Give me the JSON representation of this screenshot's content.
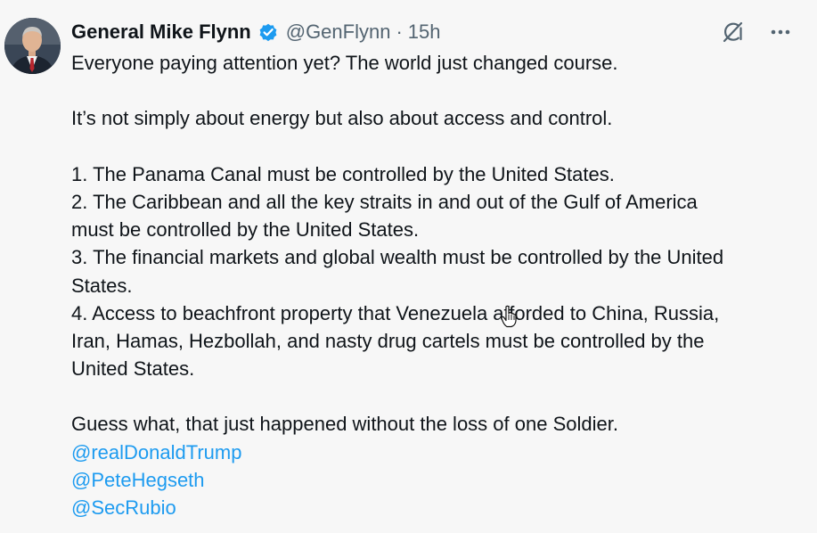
{
  "post": {
    "display_name": "General Mike Flynn",
    "handle": "@GenFlynn",
    "separator": "·",
    "time": "15h",
    "verified_icon": "verified-badge-icon",
    "actions": {
      "grok_icon": "grok-icon",
      "more_icon": "more-horizontal-icon"
    },
    "lines": [
      "Everyone paying attention yet? The world just changed course.",
      "",
      "It’s not simply about energy but also about access and control.",
      "",
      "1. The Panama Canal must be controlled by the United States.",
      "2. The Caribbean and all the key straits in and out of the Gulf of America",
      "must be controlled by the United States.",
      "3. The financial markets and global wealth must be controlled by the United",
      "States.",
      "4. Access to beachfront property that Venezuela afforded to China, Russia,",
      "Iran, Hamas, Hezbollah, and nasty drug cartels must be controlled by the",
      "United States.",
      "",
      "Guess what, that just happened without the loss of one Soldier."
    ],
    "mentions": [
      "@realDonaldTrump",
      "@PeteHegseth",
      "@SecRubio"
    ]
  },
  "colors": {
    "background": "#f7f7f7",
    "text": "#0f1419",
    "secondary": "#536471",
    "link": "#1d9bf0",
    "verified": "#1d9bf0"
  }
}
